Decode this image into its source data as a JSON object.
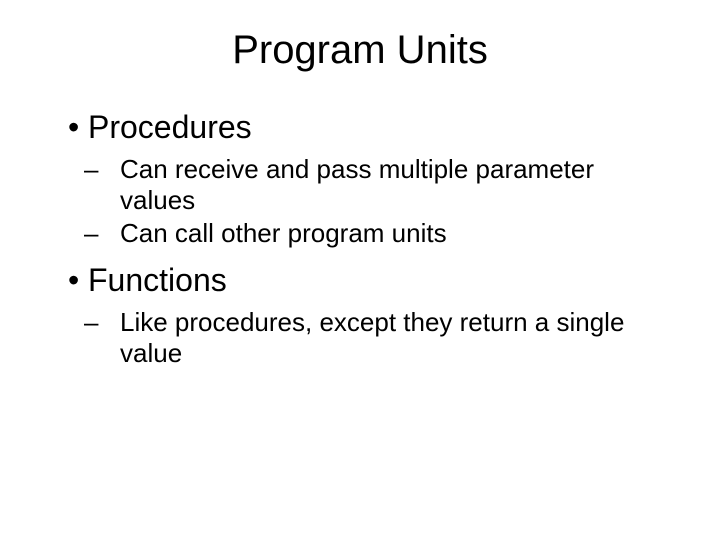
{
  "title": "Program Units",
  "sections": [
    {
      "heading": "Procedures",
      "items": [
        "Can receive and pass multiple parameter values",
        "Can call other program units"
      ]
    },
    {
      "heading": "Functions",
      "items": [
        "Like procedures, except they return a single value"
      ]
    }
  ]
}
